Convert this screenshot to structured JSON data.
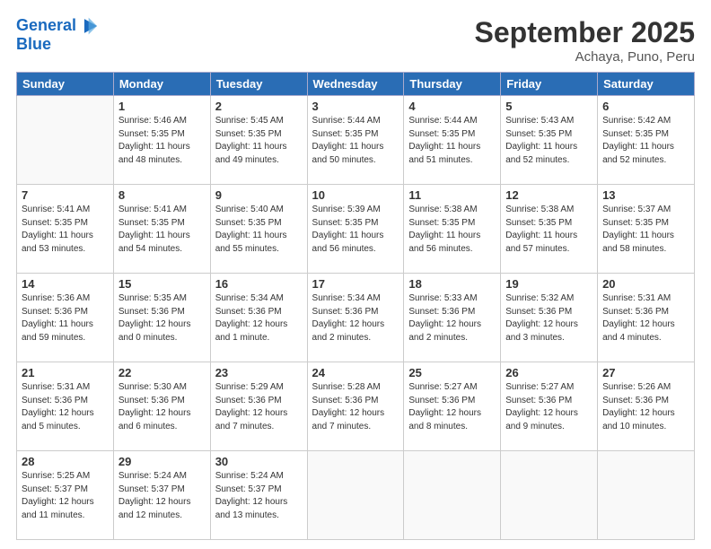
{
  "header": {
    "logo_line1": "General",
    "logo_line2": "Blue",
    "month": "September 2025",
    "location": "Achaya, Puno, Peru"
  },
  "days_of_week": [
    "Sunday",
    "Monday",
    "Tuesday",
    "Wednesday",
    "Thursday",
    "Friday",
    "Saturday"
  ],
  "weeks": [
    [
      {
        "day": "",
        "info": ""
      },
      {
        "day": "1",
        "info": "Sunrise: 5:46 AM\nSunset: 5:35 PM\nDaylight: 11 hours\nand 48 minutes."
      },
      {
        "day": "2",
        "info": "Sunrise: 5:45 AM\nSunset: 5:35 PM\nDaylight: 11 hours\nand 49 minutes."
      },
      {
        "day": "3",
        "info": "Sunrise: 5:44 AM\nSunset: 5:35 PM\nDaylight: 11 hours\nand 50 minutes."
      },
      {
        "day": "4",
        "info": "Sunrise: 5:44 AM\nSunset: 5:35 PM\nDaylight: 11 hours\nand 51 minutes."
      },
      {
        "day": "5",
        "info": "Sunrise: 5:43 AM\nSunset: 5:35 PM\nDaylight: 11 hours\nand 52 minutes."
      },
      {
        "day": "6",
        "info": "Sunrise: 5:42 AM\nSunset: 5:35 PM\nDaylight: 11 hours\nand 52 minutes."
      }
    ],
    [
      {
        "day": "7",
        "info": "Sunrise: 5:41 AM\nSunset: 5:35 PM\nDaylight: 11 hours\nand 53 minutes."
      },
      {
        "day": "8",
        "info": "Sunrise: 5:41 AM\nSunset: 5:35 PM\nDaylight: 11 hours\nand 54 minutes."
      },
      {
        "day": "9",
        "info": "Sunrise: 5:40 AM\nSunset: 5:35 PM\nDaylight: 11 hours\nand 55 minutes."
      },
      {
        "day": "10",
        "info": "Sunrise: 5:39 AM\nSunset: 5:35 PM\nDaylight: 11 hours\nand 56 minutes."
      },
      {
        "day": "11",
        "info": "Sunrise: 5:38 AM\nSunset: 5:35 PM\nDaylight: 11 hours\nand 56 minutes."
      },
      {
        "day": "12",
        "info": "Sunrise: 5:38 AM\nSunset: 5:35 PM\nDaylight: 11 hours\nand 57 minutes."
      },
      {
        "day": "13",
        "info": "Sunrise: 5:37 AM\nSunset: 5:35 PM\nDaylight: 11 hours\nand 58 minutes."
      }
    ],
    [
      {
        "day": "14",
        "info": "Sunrise: 5:36 AM\nSunset: 5:36 PM\nDaylight: 11 hours\nand 59 minutes."
      },
      {
        "day": "15",
        "info": "Sunrise: 5:35 AM\nSunset: 5:36 PM\nDaylight: 12 hours\nand 0 minutes."
      },
      {
        "day": "16",
        "info": "Sunrise: 5:34 AM\nSunset: 5:36 PM\nDaylight: 12 hours\nand 1 minute."
      },
      {
        "day": "17",
        "info": "Sunrise: 5:34 AM\nSunset: 5:36 PM\nDaylight: 12 hours\nand 2 minutes."
      },
      {
        "day": "18",
        "info": "Sunrise: 5:33 AM\nSunset: 5:36 PM\nDaylight: 12 hours\nand 2 minutes."
      },
      {
        "day": "19",
        "info": "Sunrise: 5:32 AM\nSunset: 5:36 PM\nDaylight: 12 hours\nand 3 minutes."
      },
      {
        "day": "20",
        "info": "Sunrise: 5:31 AM\nSunset: 5:36 PM\nDaylight: 12 hours\nand 4 minutes."
      }
    ],
    [
      {
        "day": "21",
        "info": "Sunrise: 5:31 AM\nSunset: 5:36 PM\nDaylight: 12 hours\nand 5 minutes."
      },
      {
        "day": "22",
        "info": "Sunrise: 5:30 AM\nSunset: 5:36 PM\nDaylight: 12 hours\nand 6 minutes."
      },
      {
        "day": "23",
        "info": "Sunrise: 5:29 AM\nSunset: 5:36 PM\nDaylight: 12 hours\nand 7 minutes."
      },
      {
        "day": "24",
        "info": "Sunrise: 5:28 AM\nSunset: 5:36 PM\nDaylight: 12 hours\nand 7 minutes."
      },
      {
        "day": "25",
        "info": "Sunrise: 5:27 AM\nSunset: 5:36 PM\nDaylight: 12 hours\nand 8 minutes."
      },
      {
        "day": "26",
        "info": "Sunrise: 5:27 AM\nSunset: 5:36 PM\nDaylight: 12 hours\nand 9 minutes."
      },
      {
        "day": "27",
        "info": "Sunrise: 5:26 AM\nSunset: 5:36 PM\nDaylight: 12 hours\nand 10 minutes."
      }
    ],
    [
      {
        "day": "28",
        "info": "Sunrise: 5:25 AM\nSunset: 5:37 PM\nDaylight: 12 hours\nand 11 minutes."
      },
      {
        "day": "29",
        "info": "Sunrise: 5:24 AM\nSunset: 5:37 PM\nDaylight: 12 hours\nand 12 minutes."
      },
      {
        "day": "30",
        "info": "Sunrise: 5:24 AM\nSunset: 5:37 PM\nDaylight: 12 hours\nand 13 minutes."
      },
      {
        "day": "",
        "info": ""
      },
      {
        "day": "",
        "info": ""
      },
      {
        "day": "",
        "info": ""
      },
      {
        "day": "",
        "info": ""
      }
    ]
  ]
}
